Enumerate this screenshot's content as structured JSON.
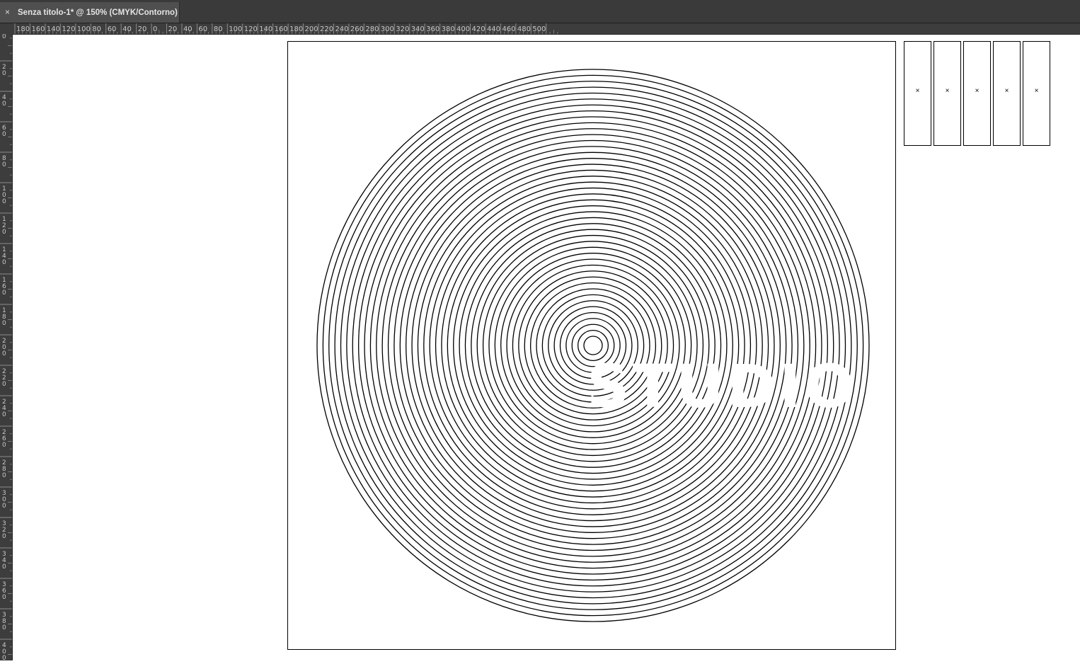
{
  "window": {
    "tab_close_glyph": "×",
    "tab_title": "Senza titolo-1* @ 150% (CMYK/Contorno)"
  },
  "rulers": {
    "horizontal_labels": [
      "180",
      "160",
      "140",
      "120",
      "100",
      "80",
      "60",
      "40",
      "20",
      "0",
      "20",
      "40",
      "60",
      "80",
      "100",
      "120",
      "140",
      "160",
      "180",
      "200",
      "220",
      "240",
      "260",
      "280",
      "300",
      "320",
      "340",
      "360",
      "380",
      "400",
      "420",
      "440",
      "460",
      "480",
      "500"
    ],
    "vertical_labels": [
      "0",
      "20",
      "40",
      "60",
      "80",
      "100",
      "120",
      "140",
      "160",
      "180",
      "200",
      "220",
      "240",
      "260",
      "280",
      "300",
      "320",
      "340",
      "360",
      "380",
      "400"
    ]
  },
  "artwork": {
    "ring_count": 46,
    "text": "STUDIO",
    "stroke_color": "#000000"
  },
  "thumbnails": [
    {
      "mark": "×"
    },
    {
      "mark": "×"
    },
    {
      "mark": "×"
    },
    {
      "mark": "×"
    },
    {
      "mark": "×"
    }
  ],
  "colors": {
    "chrome_dark": "#3a3a3a",
    "tab_active": "#4f4f4f",
    "ruler_bg": "#3d3d3d",
    "ruler_text": "#c8c8c8",
    "canvas_bg": "#ffffff"
  }
}
